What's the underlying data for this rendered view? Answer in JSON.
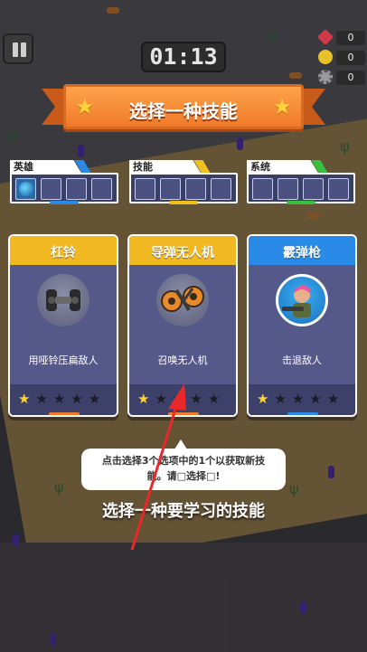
{
  "hud": {
    "timer": "01:13",
    "resources": [
      {
        "icon": "gem-icon",
        "value": "0",
        "color": "#d23a4a"
      },
      {
        "icon": "coin-icon",
        "value": "0",
        "color": "#e8c02a"
      },
      {
        "icon": "gear-icon",
        "value": "0",
        "color": "#9a9a9a"
      }
    ]
  },
  "banner": {
    "title": "选择一种技能"
  },
  "categories": [
    {
      "label": "英雄",
      "accent": "#2a8ae8"
    },
    {
      "label": "技能",
      "accent": "#f0c020"
    },
    {
      "label": "系统",
      "accent": "#38c040"
    }
  ],
  "skills": [
    {
      "name": "杠铃",
      "description": "用哑铃压扁敌人",
      "stars": 1,
      "max_stars": 5,
      "header_color": "#f2b822",
      "icon": "dumbbell-icon"
    },
    {
      "name": "导弹无人机",
      "description": "召唤无人机",
      "stars": 1,
      "max_stars": 5,
      "header_color": "#f2b822",
      "icon": "drone-icon"
    },
    {
      "name": "霰弹枪",
      "description": "击退敌人",
      "stars": 1,
      "max_stars": 5,
      "header_color": "#2a8ae8",
      "icon": "shotgun-hero-icon"
    }
  ],
  "tutorial": {
    "tooltip_line1": "点击选择3个选项中的1个以获取新技",
    "tooltip_line2": "能。请□选择□!",
    "hint": "选择一种要学习的技能"
  },
  "colors": {
    "accent_orange": "#f07a2a",
    "card_bg": "#4b4e7a",
    "star_on": "#ffd23a"
  }
}
